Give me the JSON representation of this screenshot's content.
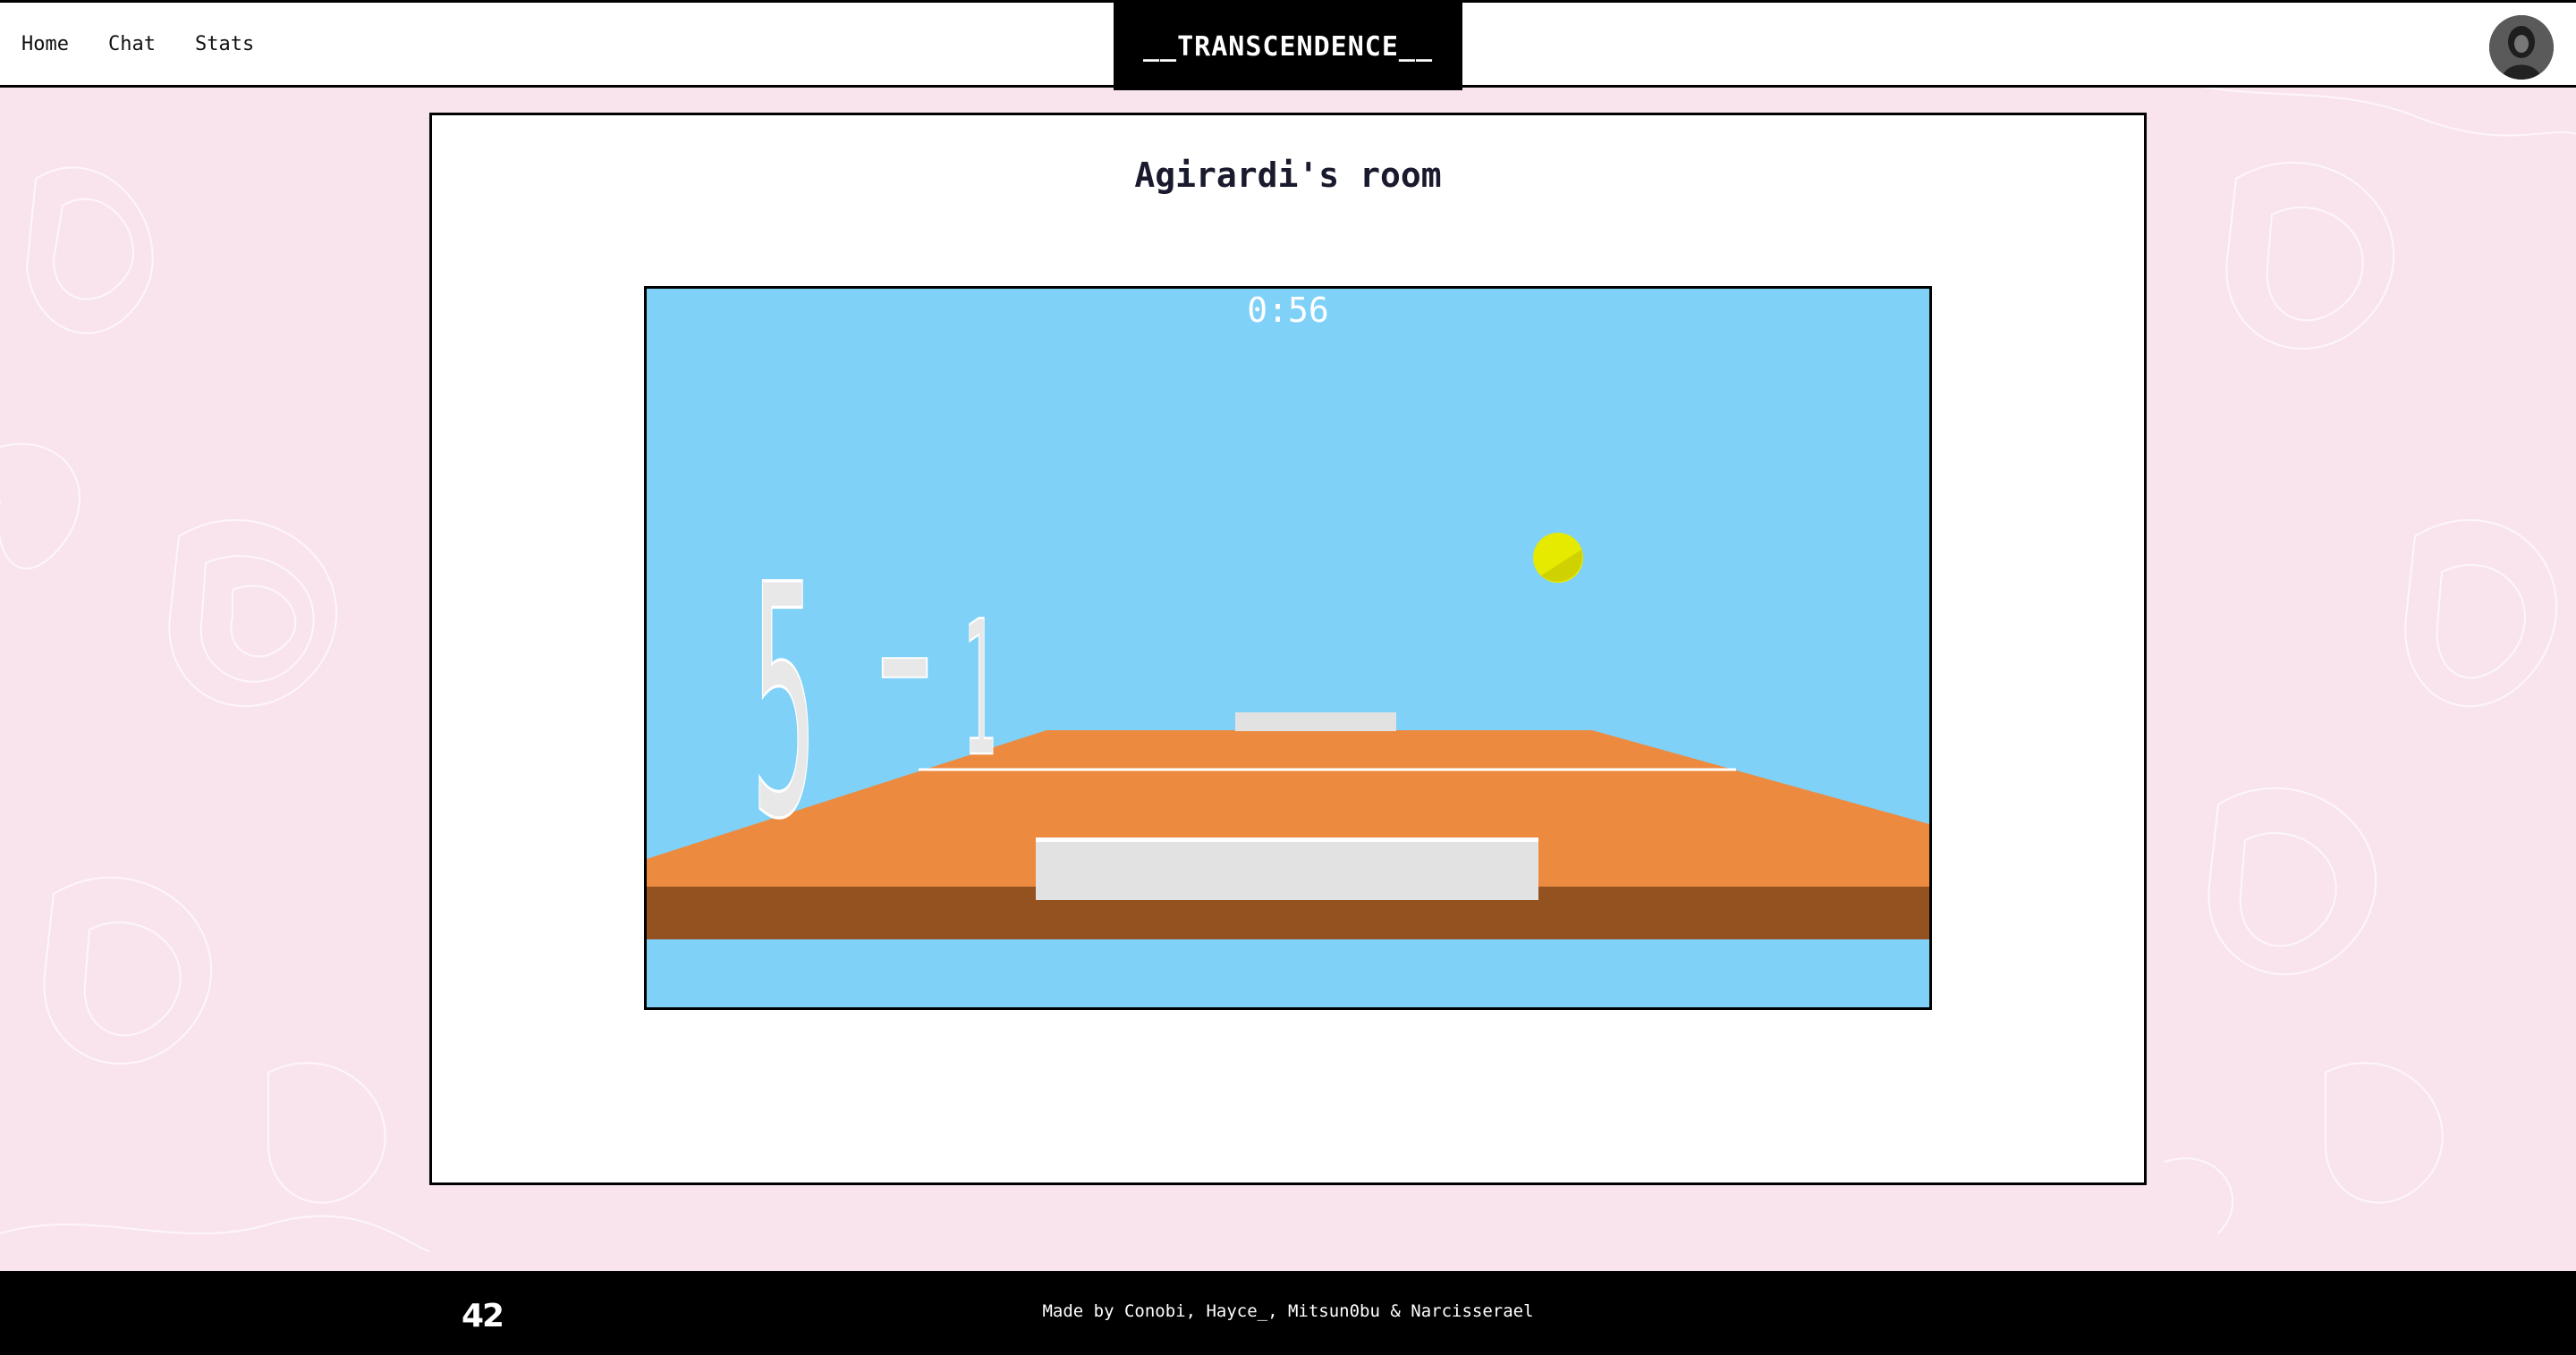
{
  "nav": {
    "home": "Home",
    "chat": "Chat",
    "stats": "Stats"
  },
  "brand": "__TRANSCENDENCE__",
  "room": {
    "title": "Agirardi's room"
  },
  "game": {
    "timer": "0:56",
    "score_left": "5",
    "score_separator": "-",
    "score_right": "1"
  },
  "footer": {
    "logo": "42",
    "credits": "Made by Conobi, Hayce_, Mitsun0bu & Narcisserael"
  },
  "colors": {
    "sky": "#7fd1f8",
    "table_top": "#ec8b40",
    "table_side": "#93521f",
    "ball": "#e5ea00",
    "paddle": "#e2e2e2",
    "background": "#f9e4ee"
  }
}
